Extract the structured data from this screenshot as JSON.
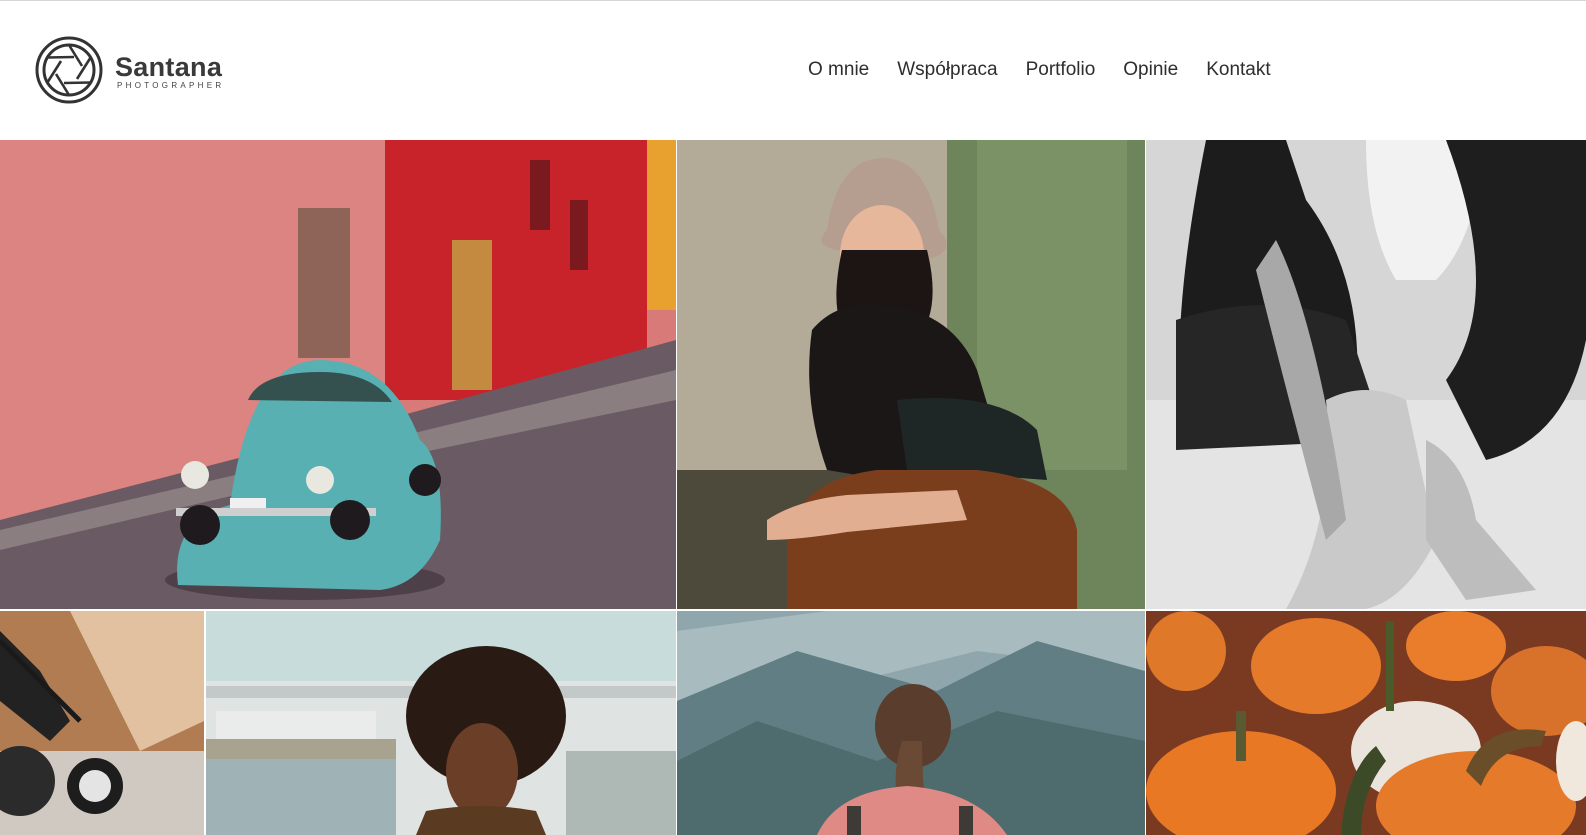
{
  "site": {
    "brand": "Santana",
    "tagline": "PHOTOGRAPHER"
  },
  "nav": {
    "items": [
      "O mnie",
      "Współpraca",
      "Portfolio",
      "Opinie",
      "Kontakt"
    ]
  },
  "colors": {
    "text": "#2e2e2e",
    "background": "#ffffff"
  },
  "gallery": {
    "photos": [
      {
        "subject": "turquoise-beetle-car-street"
      },
      {
        "subject": "woman-bucket-hat-sitting"
      },
      {
        "subject": "black-white-seated-legs"
      },
      {
        "subject": "motorcycle-brick-wall"
      },
      {
        "subject": "man-afro-train"
      },
      {
        "subject": "woman-ponytail-mountains"
      },
      {
        "subject": "pumpkins"
      }
    ]
  }
}
